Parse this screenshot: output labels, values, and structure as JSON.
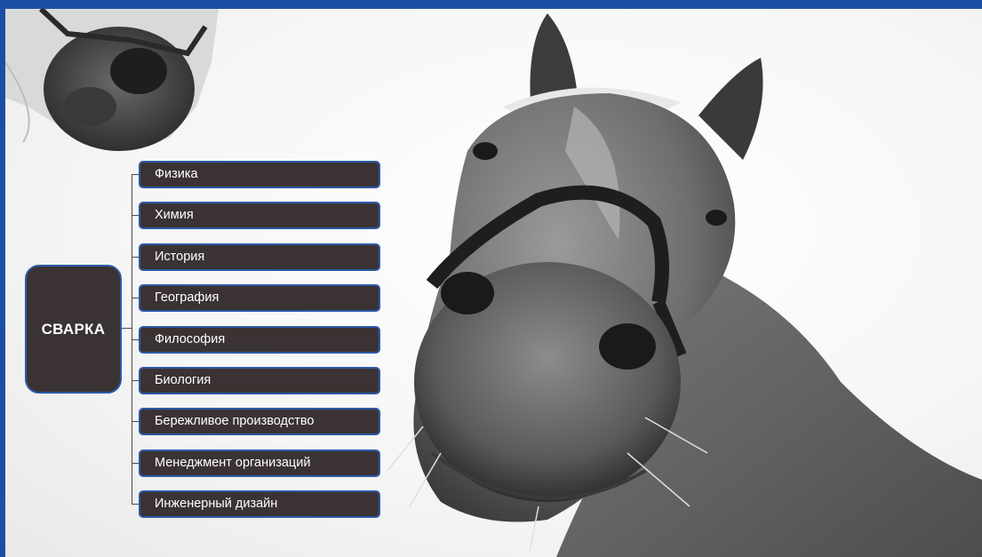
{
  "diagram": {
    "root_label": "СВАРКА",
    "items": [
      {
        "label": "Физика"
      },
      {
        "label": "Химия"
      },
      {
        "label": "История"
      },
      {
        "label": "География"
      },
      {
        "label": "Философия"
      },
      {
        "label": "Биология"
      },
      {
        "label": "Бережливое производство"
      },
      {
        "label": "Менеджмент организаций"
      },
      {
        "label": "Инженерный дизайн"
      }
    ]
  },
  "colors": {
    "frame": "#1c4fa3",
    "box_fill": "#3b3233",
    "box_border": "#2c5aa8",
    "text": "#ffffff"
  },
  "image": {
    "description_icon": "horse-photo"
  }
}
